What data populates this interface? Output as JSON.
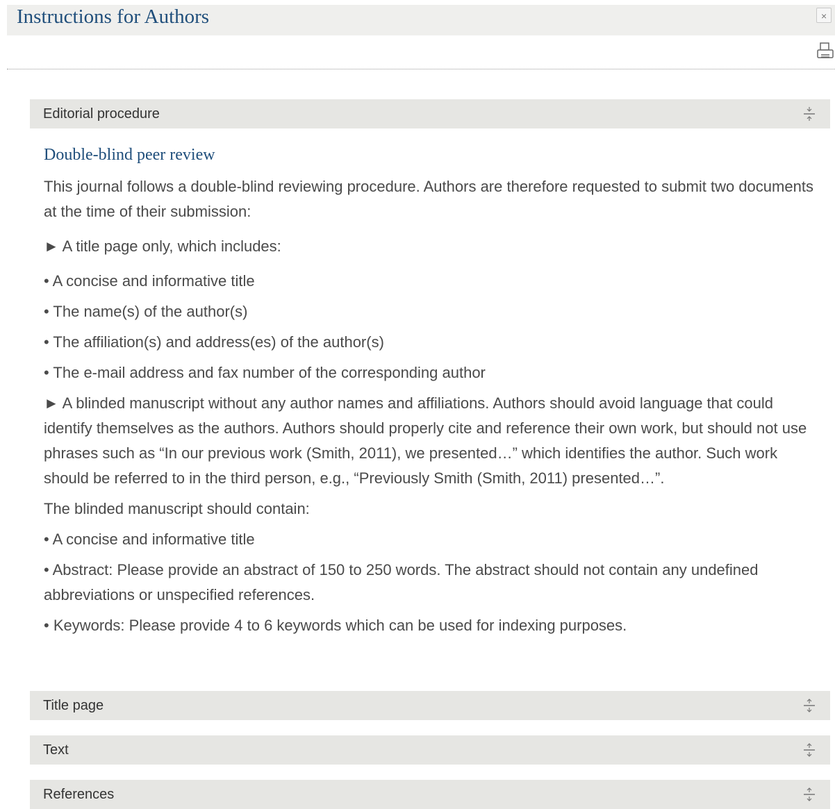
{
  "page": {
    "title": "Instructions for Authors",
    "close_label": "×"
  },
  "icons": {
    "close": "close-icon",
    "print": "printer-icon",
    "collapse": "collapse-icon",
    "expand": "expand-icon"
  },
  "sections": [
    {
      "label": "Editorial procedure",
      "state": "expanded"
    },
    {
      "label": "Title page",
      "state": "collapsed"
    },
    {
      "label": "Text",
      "state": "collapsed"
    },
    {
      "label": "References",
      "state": "collapsed"
    }
  ],
  "editorial": {
    "heading": "Double-blind peer review",
    "paragraphs": [
      "This journal follows a double-blind reviewing procedure. Authors are therefore requested to submit two documents at the time of their submission:",
      "► A title page only, which includes:",
      "• A concise and informative title",
      "• The name(s) of the author(s)",
      "• The affiliation(s) and address(es) of the author(s)",
      "• The e-mail address and fax number of the corresponding author",
      "► A blinded manuscript without any author names and affiliations. Authors should avoid language that could identify themselves as the authors. Authors should properly cite and reference their own work, but should not use phrases such as “In our previous work (Smith, 2011), we presented…” which identifies the author. Such work should be referred to in the third person, e.g., “Previously Smith (Smith, 2011) presented…”.",
      "The blinded manuscript should contain:",
      "• A concise and informative title",
      "• Abstract: Please provide an abstract of 150 to 250 words. The abstract should not contain any undefined abbreviations or unspecified references.",
      "• Keywords: Please provide 4 to 6 keywords which can be used for indexing purposes."
    ]
  },
  "colors": {
    "title_blue": "#1f4e7b",
    "header_bg": "#e6e6e3",
    "title_bar_bg": "#efefed",
    "body_text": "#4a4a4a"
  }
}
